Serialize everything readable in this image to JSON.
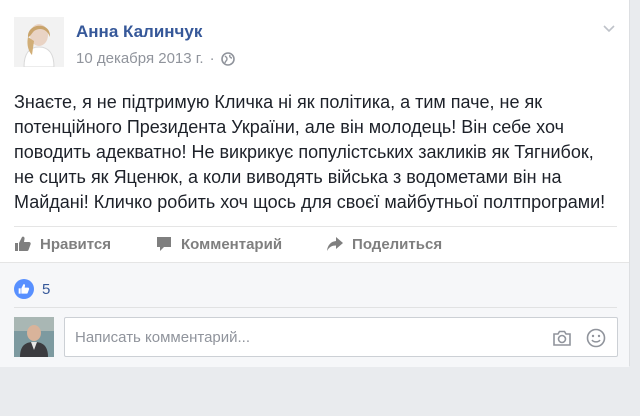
{
  "post": {
    "author": "Анна Калинчук",
    "date": "10 декабря 2013 г.",
    "separator": "·",
    "text": "Знаєте, я не підтримую Кличка ні як політика, а тим паче, не як потенційного Президента України, але він молодець! Він себе хоч поводить адекватно! Не викрикує популістських закликів як Тягнибок, не сцить як Яценюк, а коли виводять війська з водометами він на Майдані! Кличко робить хоч щось для своєї майбутньої полтпрограми!"
  },
  "actions": {
    "like_label": "Нравится",
    "comment_label": "Комментарий",
    "share_label": "Поделиться"
  },
  "reactions": {
    "like_count": "5"
  },
  "comment": {
    "placeholder": "Написать комментарий..."
  },
  "colors": {
    "link_blue": "#365899",
    "like_blue": "#5890ff",
    "muted": "#90949c"
  }
}
